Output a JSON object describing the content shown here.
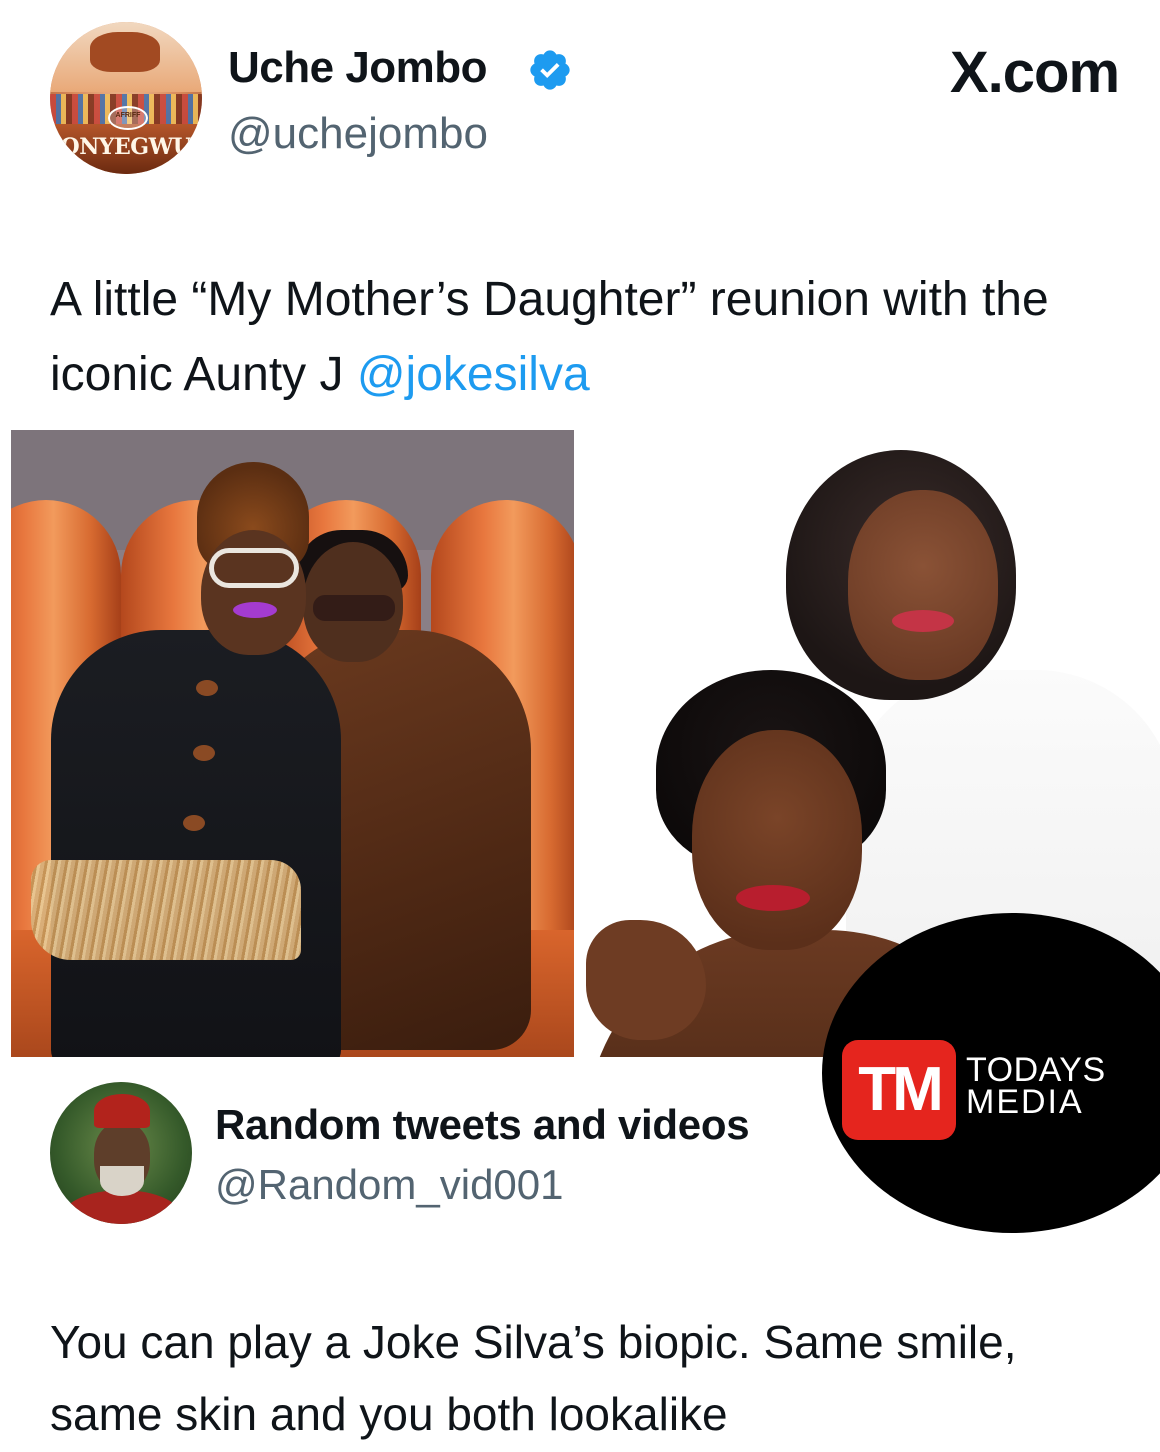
{
  "brand": {
    "site_label": "X.com"
  },
  "tweet1": {
    "avatar_caption": "ONYEGWU",
    "avatar_award": "AFRIFF",
    "author_name": "Uche Jombo",
    "handle": "@uchejombo",
    "verified": true,
    "text_before_mention": "A little “My Mother’s Daughter” reunion with the iconic Aunty J ",
    "mention": "@jokesilva"
  },
  "tweet2": {
    "author_name": "Random tweets and videos",
    "handle": "@Random_vid001",
    "text": "You can play a Joke Silva’s biopic. Same smile, same skin and you both lookalike"
  },
  "watermark": {
    "logo": "TM",
    "line1": "TODAYS",
    "line2": "MEDIA"
  },
  "colors": {
    "link": "#1d9bf0",
    "verified": "#1d9bf0",
    "secondary_text": "#536471",
    "watermark_red": "#e5251e"
  }
}
